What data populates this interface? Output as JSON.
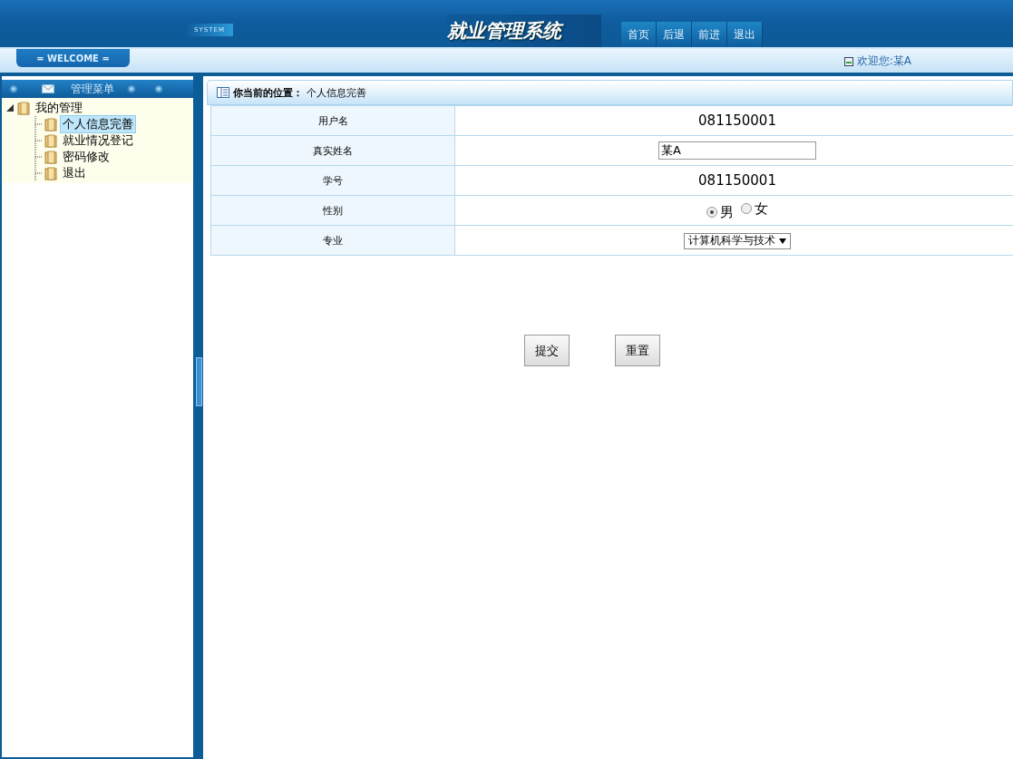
{
  "header": {
    "tag": "SYSTEM",
    "title": "就业管理系统",
    "nav": [
      "首页",
      "后退",
      "前进",
      "退出"
    ]
  },
  "welcome_tab": "= WELCOME =",
  "greeting": "欢迎您:某A",
  "sidebar": {
    "title": "管理菜单",
    "tree": [
      {
        "label": "我的管理",
        "selected": false,
        "expanded": true,
        "children": [
          {
            "label": "个人信息完善",
            "selected": true
          },
          {
            "label": "就业情况登记",
            "selected": false
          },
          {
            "label": "密码修改",
            "selected": false
          },
          {
            "label": "退出",
            "selected": false
          }
        ]
      }
    ]
  },
  "breadcrumb": {
    "label": "你当前的位置：",
    "current": "个人信息完善"
  },
  "form": [
    {
      "label": "用户名",
      "kind": "text",
      "value": "081150001"
    },
    {
      "label": "真实姓名",
      "kind": "input",
      "value": "某A"
    },
    {
      "label": "学号",
      "kind": "text",
      "value": "081150001"
    },
    {
      "label": "性别",
      "kind": "radio",
      "options": [
        {
          "label": "男",
          "selected": true
        },
        {
          "label": "女",
          "selected": false
        }
      ]
    },
    {
      "label": "专业",
      "kind": "select",
      "value": "计算机科学与技术"
    }
  ],
  "buttons": [
    "提交",
    "重置"
  ]
}
